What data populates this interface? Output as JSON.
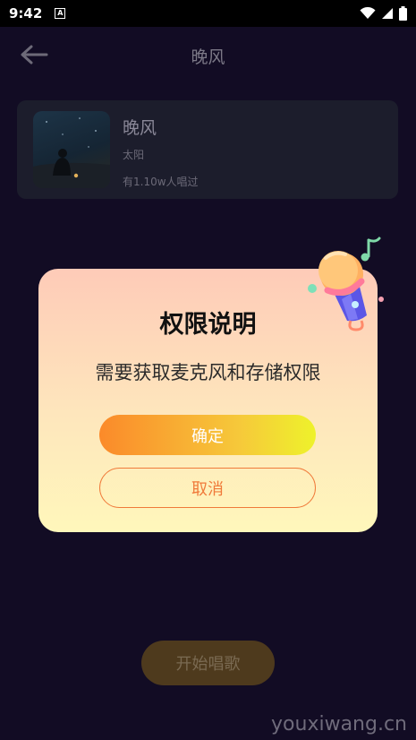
{
  "status_bar": {
    "time": "9:42",
    "notification_letter": "A",
    "icons": [
      "wifi-icon",
      "signal-icon",
      "battery-icon"
    ]
  },
  "header": {
    "back_icon": "arrow-left-icon",
    "title": "晚风"
  },
  "song": {
    "title": "晚风",
    "artist": "太阳",
    "sung_count": "有1.10w人唱过"
  },
  "footer": {
    "start_label": "开始唱歌"
  },
  "dialog": {
    "title": "权限说明",
    "message": "需要获取麦克风和存储权限",
    "confirm_label": "确定",
    "cancel_label": "取消",
    "illustration": "microphone-icon"
  },
  "watermark": "youxiwang.cn",
  "colors": {
    "background": "#120c24",
    "accent_orange": "#f07a3a",
    "accent_yellow": "#eef22b"
  }
}
